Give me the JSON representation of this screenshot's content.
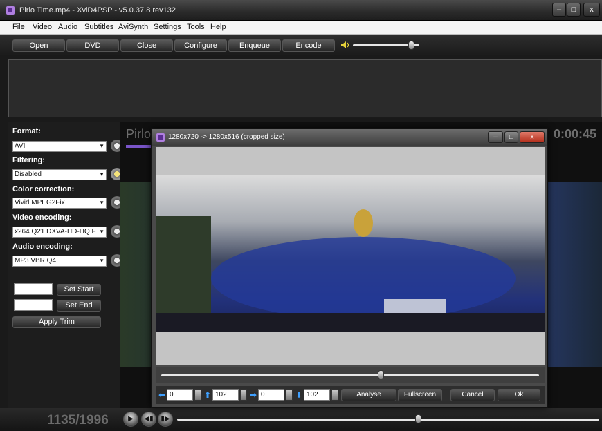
{
  "window": {
    "title": "Pirlo Time.mp4  - XviD4PSP - v5.0.37.8  rev132",
    "minimize": "‒",
    "maximize": "□",
    "close": "x"
  },
  "menu": [
    "File",
    "Video",
    "Audio",
    "Subtitles",
    "AviSynth",
    "Settings",
    "Tools",
    "Help"
  ],
  "toolbar": {
    "open": "Open",
    "dvd": "DVD",
    "close": "Close",
    "configure": "Configure",
    "enqueue": "Enqueue",
    "encode": "Encode",
    "volume_fraction": 0.88
  },
  "settings": {
    "format_label": "Format:",
    "format_value": "AVI",
    "filtering_label": "Filtering:",
    "filtering_value": "Disabled",
    "color_label": "Color correction:",
    "color_value": "Vivid MPEG2Fix",
    "video_label": "Video encoding:",
    "video_value": "x264 Q21 DXVA-HD-HQ F",
    "audio_label": "Audio encoding:",
    "audio_value": "MP3 VBR Q4",
    "set_start": "Set Start",
    "set_end": "Set End",
    "apply_trim": "Apply Trim"
  },
  "preview": {
    "filename": "Pirlo",
    "time": "0:00:45",
    "frame_counter": "1135/1996",
    "position_fraction": 0.57
  },
  "crop_dialog": {
    "title": "1280x720 -> 1280x516 (cropped size)",
    "left": "0",
    "top": "102",
    "right": "0",
    "bottom": "102",
    "analyse": "Analyse",
    "fullscreen": "Fullscreen",
    "cancel": "Cancel",
    "ok": "Ok",
    "slider_fraction": 0.58
  }
}
